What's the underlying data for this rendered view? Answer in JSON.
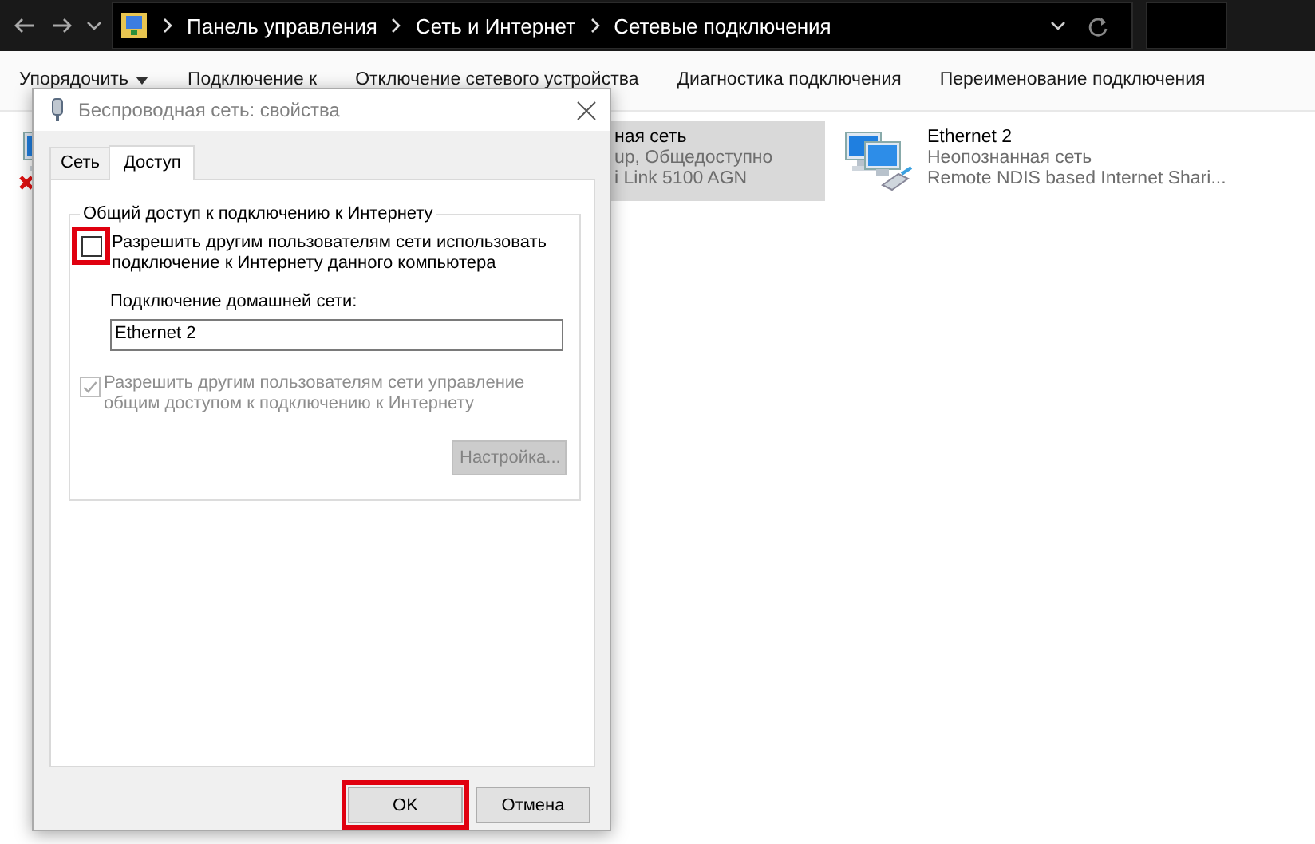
{
  "address_bar": {
    "path": [
      "Панель управления",
      "Сеть и Интернет",
      "Сетевые подключения"
    ]
  },
  "toolbar": {
    "items": [
      {
        "label": "Упорядочить",
        "kind": "menu"
      },
      {
        "label": "Подключение к",
        "kind": "command"
      },
      {
        "label": "Отключение сетевого устройства",
        "kind": "command"
      },
      {
        "label": "Диагностика подключения",
        "kind": "command"
      },
      {
        "label": "Переименование подключения",
        "kind": "command"
      }
    ]
  },
  "connections": [
    {
      "disconnected": true,
      "selected": false
    },
    {
      "name": "ная сеть",
      "status": "up, Общедоступно",
      "device": "i Link 5100 AGN",
      "selected": true
    },
    {
      "name": "Ethernet 2",
      "status": "Неопознанная сеть",
      "device": "Remote NDIS based Internet Shari...",
      "disconnected": false,
      "selected": false
    }
  ],
  "dialog": {
    "title": "Беспроводная сеть: свойства",
    "tabs": [
      {
        "label": "Сеть",
        "selected": false
      },
      {
        "label": "Доступ",
        "selected": true
      }
    ],
    "group_title": "Общий доступ к подключению к Интернету",
    "allow_sharing": {
      "label": "Разрешить другим пользователям сети использовать подключение к Интернету данного компьютера",
      "checked": false,
      "highlighted": true
    },
    "home_network_label": "Подключение домашней сети:",
    "home_network_value": "Ethernet 2",
    "allow_control": {
      "label": "Разрешить другим пользователям сети управление общим доступом к подключению к Интернету",
      "checked": true,
      "disabled": true
    },
    "settings_button": {
      "label": "Настройка...",
      "disabled": true
    },
    "buttons": [
      {
        "label": "OK",
        "highlighted": true
      },
      {
        "label": "Отмена"
      }
    ]
  }
}
